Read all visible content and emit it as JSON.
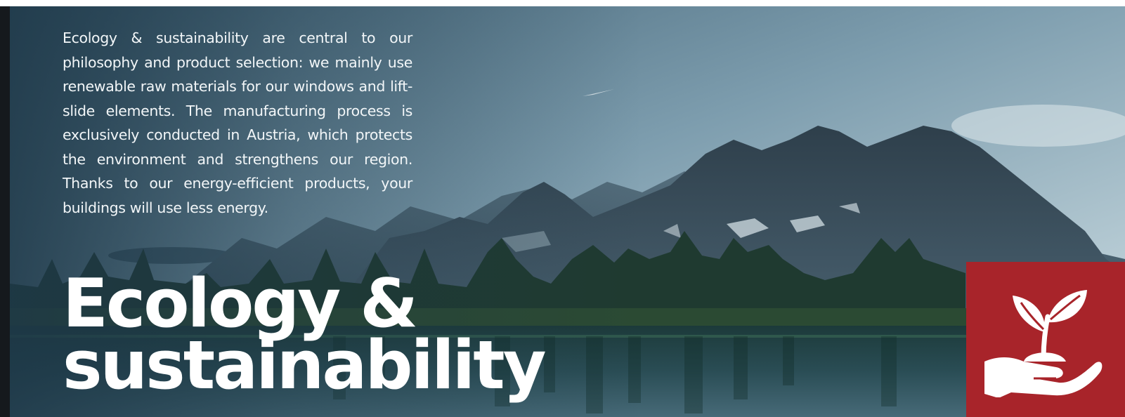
{
  "intro_text": "Ecology & sustainability are central to our philosophy and product selection: we mainly use renewable raw materials for our windows and lift-slide elements. The manufacturing process is exclusively conducted in Austria, which protects the environment and strengthens our region. Thanks to our energy-efficient products, your buildings will use less energy.",
  "headline": {
    "line1": "Ecology &",
    "line2": "sustainability"
  },
  "badge": {
    "icon": "plant-in-hand-icon",
    "color": "#a8242a"
  },
  "background": {
    "image": "mountain-lake-icon"
  }
}
